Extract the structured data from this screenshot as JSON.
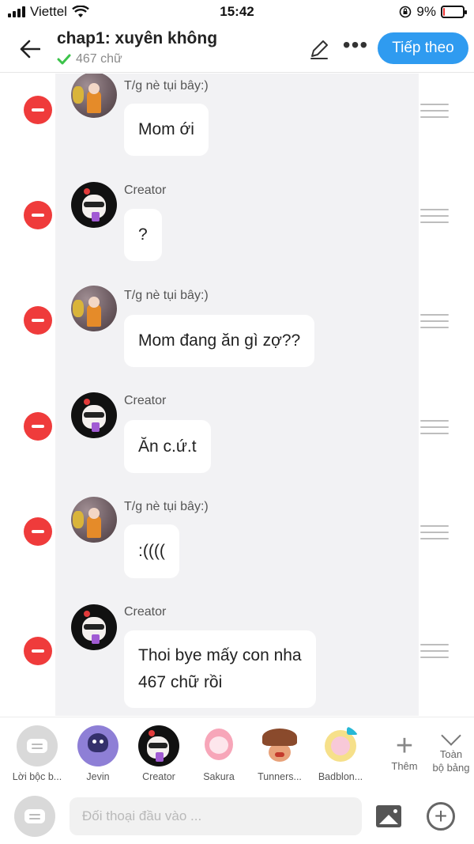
{
  "status_bar": {
    "carrier": "Viettel",
    "time": "15:42",
    "battery": "9%",
    "battery_level": 0.09,
    "icons": [
      "signal-icon",
      "wifi-icon",
      "lock-rotation-icon",
      "battery-charging-icon"
    ]
  },
  "header": {
    "title": "chap1: xuyên không",
    "word_count": "467 chữ",
    "next_button": "Tiếp theo",
    "accent_color": "#2f9bf0"
  },
  "messages": [
    {
      "speaker": "T/g nè tụi bây:)",
      "text": "Mom ới",
      "avatar": "tg"
    },
    {
      "speaker": "Creator",
      "text": "?",
      "avatar": "creator"
    },
    {
      "speaker": "T/g nè tụi bây:)",
      "text": "Mom đang ăn gì zợ??",
      "avatar": "tg"
    },
    {
      "speaker": "Creator",
      "text": "Ăn c.ứ.t",
      "avatar": "creator"
    },
    {
      "speaker": "T/g nè tụi bây:)",
      "text": ":((((",
      "avatar": "tg"
    },
    {
      "speaker": "Creator",
      "text_line1": "Thoi bye mấy con nha",
      "text_line2": "467 chữ rồi",
      "avatar": "creator"
    }
  ],
  "characters": [
    {
      "label": "Lời bộc b..."
    },
    {
      "label": "Jevin"
    },
    {
      "label": "Creator"
    },
    {
      "label": "Sakura"
    },
    {
      "label": "Tunners..."
    },
    {
      "label": "Badblon..."
    }
  ],
  "char_actions": {
    "more_label": "Thêm",
    "all_board_line1": "Toàn",
    "all_board_line2": "bộ bảng"
  },
  "input": {
    "placeholder": "Đối thoại đầu vào ...",
    "value": ""
  },
  "colors": {
    "remove": "#ef3b3b",
    "chat_bg": "#f2f2f4"
  }
}
